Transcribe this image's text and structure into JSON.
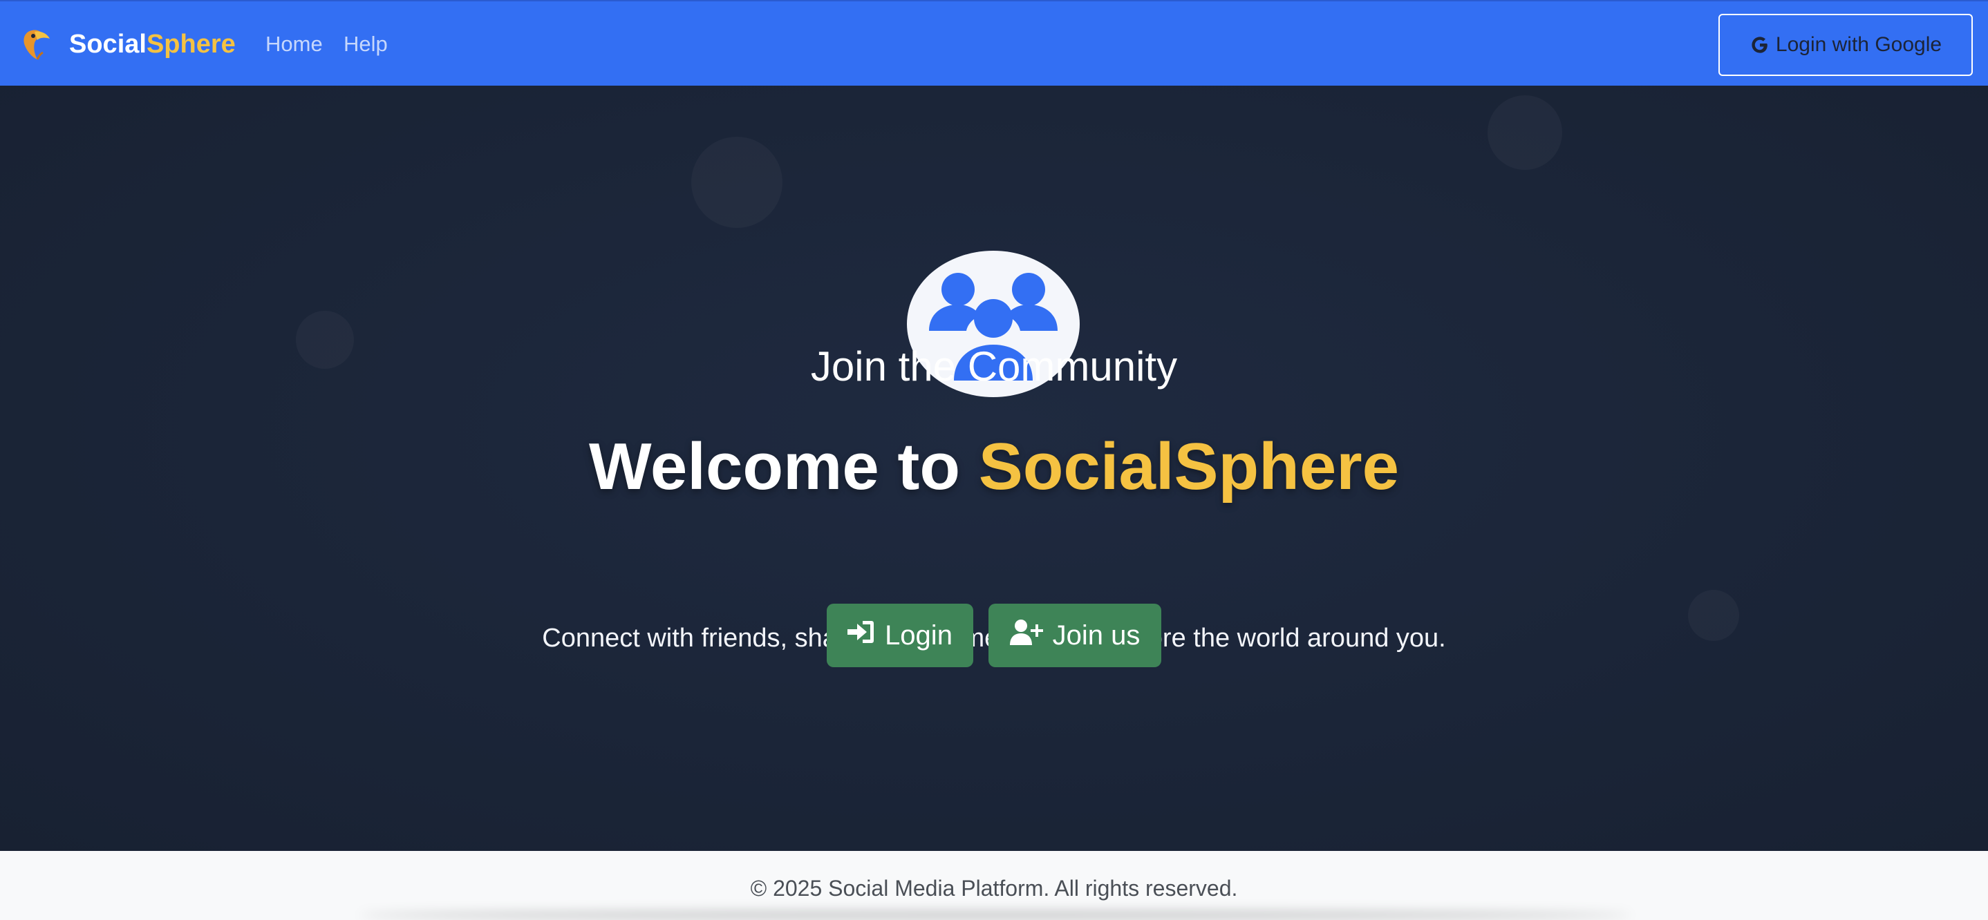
{
  "navbar": {
    "brand_part1": "Social",
    "brand_part2": "Sphere",
    "links": [
      {
        "label": "Home"
      },
      {
        "label": "Help"
      }
    ],
    "google_login_label": "Login with Google"
  },
  "hero": {
    "icon": "users-group-icon",
    "subtitle": "Join the Community",
    "headline_prefix": "Welcome to ",
    "headline_brand": "SocialSphere",
    "tagline": "Connect with friends, share your moments, and explore the world around you.",
    "buttons": {
      "login_label": "Login",
      "join_label": "Join us"
    }
  },
  "footer": {
    "copyright": "© 2025 Social Media Platform. All rights reserved."
  },
  "colors": {
    "navbar_bg": "#336ff3",
    "hero_bg": "#1c2639",
    "accent_yellow": "#f5c242",
    "button_green": "#3e8457",
    "icon_blue": "#336ff3"
  }
}
